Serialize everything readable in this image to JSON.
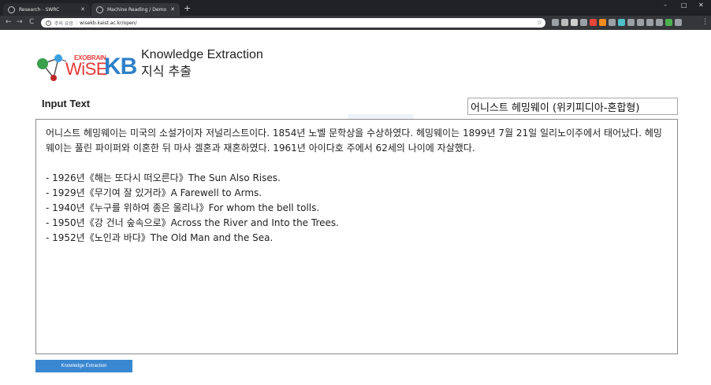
{
  "browser": {
    "tabs": [
      {
        "title": "Research - SWRC",
        "active": false
      },
      {
        "title": "Machine Reading / Demo",
        "active": true
      }
    ],
    "new_tab": "+",
    "window_controls": {
      "minimize": "–",
      "maximize": "□",
      "close": "✕"
    },
    "nav": {
      "back": "←",
      "forward": "→",
      "reload": "C"
    },
    "address": {
      "security": "주의 요망",
      "url": "wisekb.kaist.ac.kr/open/"
    },
    "extension_colors": [
      "#9aa0a6",
      "#bdbdbd",
      "#cfcfcf",
      "#9aa0a6",
      "#e8463b",
      "#f28b1e",
      "#9aa0a6",
      "#4ec0c9",
      "#9aa0a6",
      "#9aa0a6",
      "#9aa0a6",
      "#9aa0a6",
      "#4caf50",
      "#9aa0a6"
    ],
    "menu": "⋮"
  },
  "logo": {
    "exo": "EXO",
    "brain": "BRAIN",
    "wise": "WiSE",
    "kb": "KB"
  },
  "header": {
    "title_en": "Knowledge Extraction",
    "title_ko": "지식 추출"
  },
  "input": {
    "label": "Input Text",
    "document_select": "어니스트 헤밍웨이 (위키피디아-혼합형)",
    "text": "어니스트 헤밍웨이는 미국의 소설가이자 저널리스트이다. 1854년 노벨 문학상을 수상하였다. 헤밍웨이는 1899년 7월 21일 일리노이주에서 태어났다. 헤밍웨이는 풀린 파이퍼와 이혼한 뒤 마사 겔혼과 재혼하였다. 1961년 아이다호 주에서 62세의 나이에 자살했다.\n\n- 1926년《해는 또다시 떠오른다》The Sun Also Rises.\n- 1929년《무기여 잘 있거라》A Farewell to Arms.\n- 1940년《누구를 위하여 종은 울리나》For whom the bell tolls.\n- 1950년《강 건너 숲속으로》Across the River and Into the Trees.\n- 1952년《노인과 바다》The Old Man and the Sea."
  },
  "actions": {
    "extract_label": "Knowledge Extraction"
  },
  "colors": {
    "brand_red": "#e23a3a",
    "brand_blue": "#2f80c9",
    "button_blue": "#3a87d1"
  }
}
